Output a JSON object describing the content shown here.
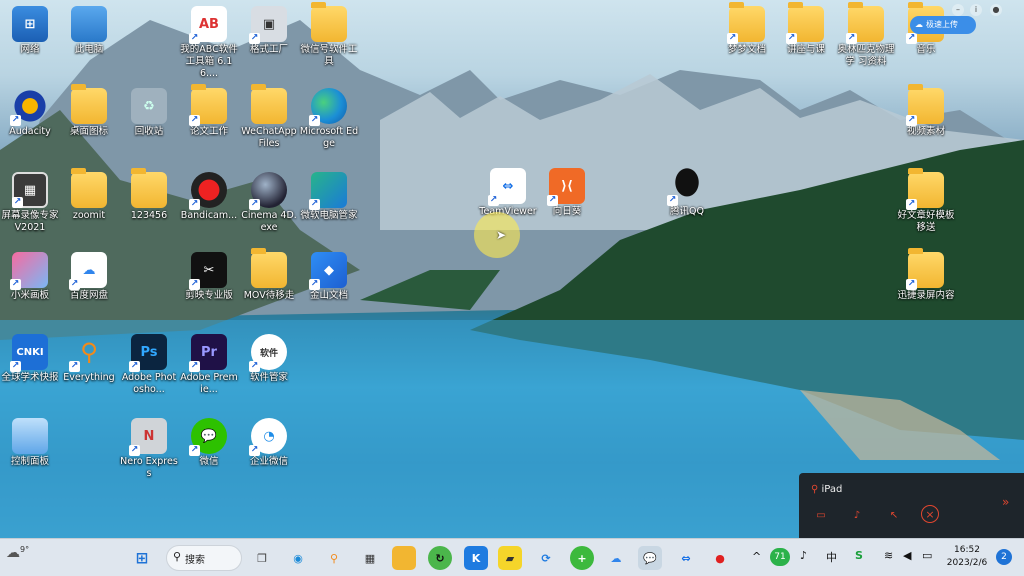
{
  "desktop_icons": [
    {
      "id": "network",
      "label": "网络"
    },
    {
      "id": "this_pc",
      "label": "此电脑"
    },
    {
      "id": "abc_toolbox",
      "label": "我的ABC软件工具箱 6.16...."
    },
    {
      "id": "format_factory",
      "label": "格式工厂"
    },
    {
      "id": "new_folder_a",
      "label": "微信号软件工具"
    },
    {
      "id": "audacity",
      "label": "Audacity"
    },
    {
      "id": "desktop_icons",
      "label": "桌面图标"
    },
    {
      "id": "recycle_bin",
      "label": "回收站"
    },
    {
      "id": "thesis_work",
      "label": "论文工作"
    },
    {
      "id": "wechat_files",
      "label": "WeChatApp Files"
    },
    {
      "id": "edge",
      "label": "Microsoft Edge"
    },
    {
      "id": "screen_recorder",
      "label": "屏幕录像专家 V2021"
    },
    {
      "id": "zoomit",
      "label": "zoomit"
    },
    {
      "id": "folder_123456",
      "label": "123456"
    },
    {
      "id": "bandicam",
      "label": "Bandicam..."
    },
    {
      "id": "cinema4d",
      "label": "Cinema 4D.exe"
    },
    {
      "id": "pc_manager",
      "label": "微软电脑管家"
    },
    {
      "id": "teamviewer",
      "label": "TeamViewer"
    },
    {
      "id": "xiangrikui",
      "label": "向日葵"
    },
    {
      "id": "qq",
      "label": "腾讯QQ"
    },
    {
      "id": "mi_board",
      "label": "小米画板"
    },
    {
      "id": "baidu_pan",
      "label": "百度网盘"
    },
    {
      "id": "capcut",
      "label": "剪映专业版"
    },
    {
      "id": "mov_folder",
      "label": "MOV待移走"
    },
    {
      "id": "kingsoft_doc",
      "label": "金山文档"
    },
    {
      "id": "cnki",
      "label": "全球学术快报"
    },
    {
      "id": "everything",
      "label": "Everything"
    },
    {
      "id": "photoshop",
      "label": "Adobe Photosho..."
    },
    {
      "id": "premiere",
      "label": "Adobe Premie..."
    },
    {
      "id": "soft_manager",
      "label": "软件管家"
    },
    {
      "id": "control_panel",
      "label": "控制面板"
    },
    {
      "id": "nero",
      "label": "Nero Express"
    },
    {
      "id": "wechat",
      "label": "微信"
    },
    {
      "id": "wecom",
      "label": "企业微信"
    },
    {
      "id": "r_folder1",
      "label": "梦梦文档"
    },
    {
      "id": "r_folder2",
      "label": "讲座与课"
    },
    {
      "id": "r_folder3",
      "label": "奥林匹克物理学 习资料"
    },
    {
      "id": "r_music",
      "label": "音乐"
    },
    {
      "id": "r_video",
      "label": "视频素材"
    },
    {
      "id": "r_paper",
      "label": "好文章好模板 移送"
    },
    {
      "id": "r_rec",
      "label": "迅捷录屏内容"
    }
  ],
  "cloud_badge": {
    "label": "极速上传"
  },
  "ipad_panel": {
    "device": "iPad"
  },
  "taskbar": {
    "search_label": "搜索",
    "weather_temp": "9°",
    "badge_71": "71",
    "ime": "中",
    "time": "16:52",
    "date": "2023/2/6",
    "notify": "2"
  },
  "colors": {
    "accent": "#1c5fd6",
    "ipad_red": "#e0462f"
  }
}
